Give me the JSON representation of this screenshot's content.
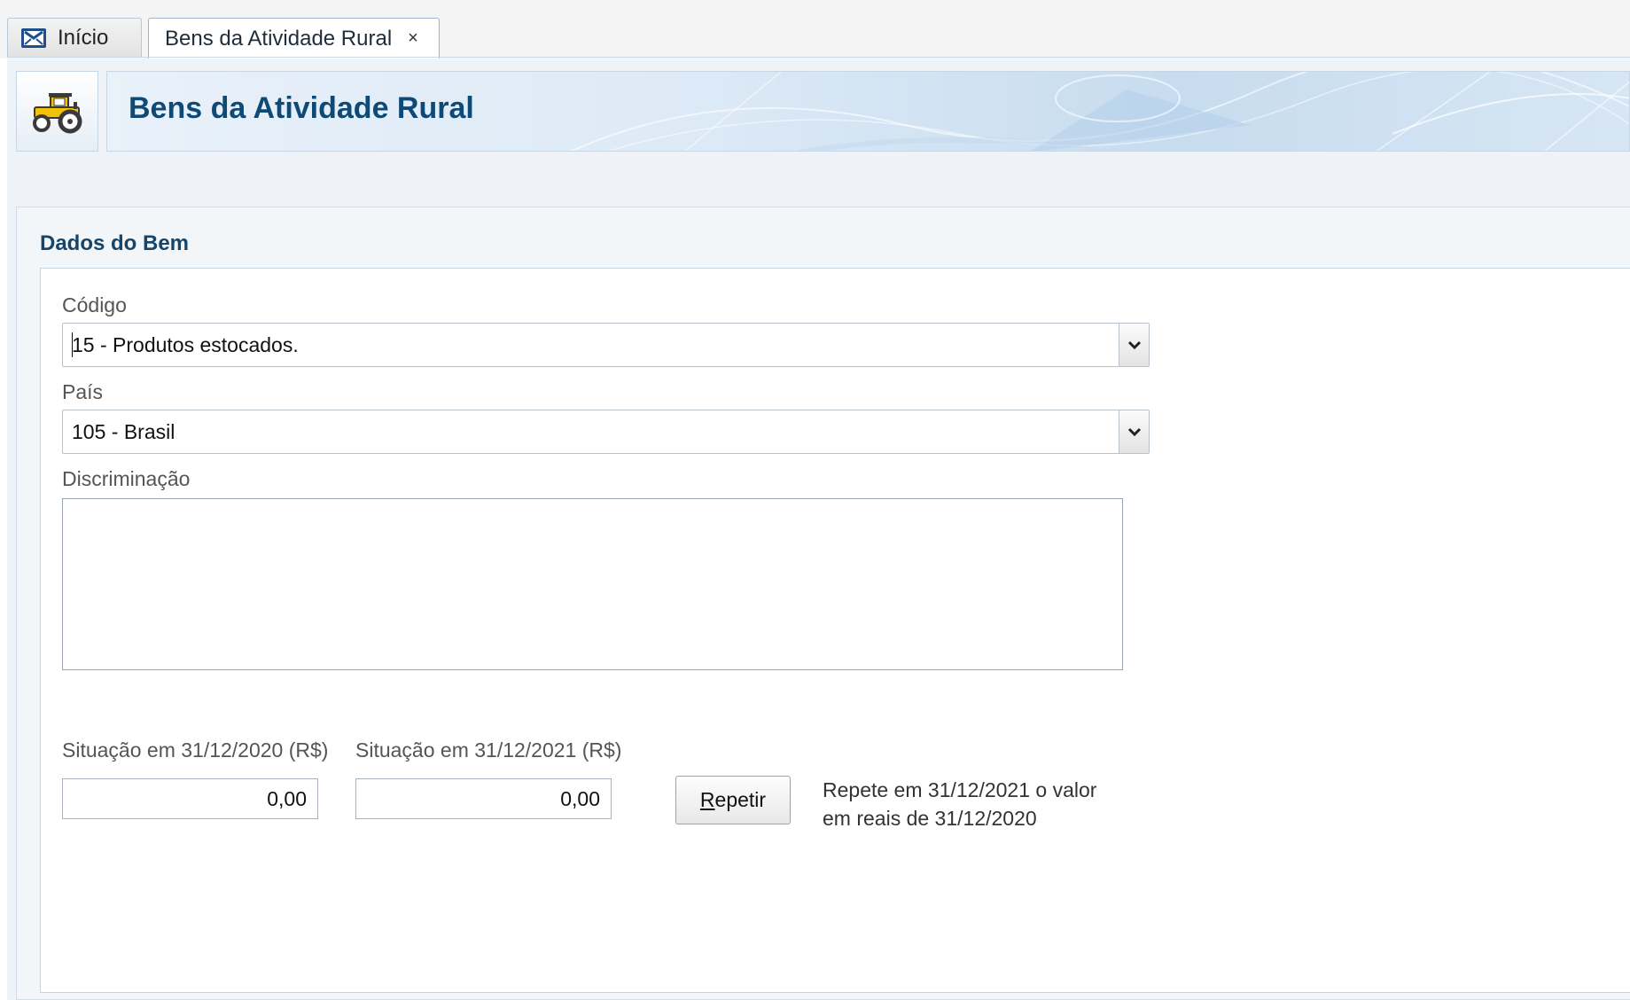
{
  "tabs": {
    "home_label": "Início",
    "active_label": "Bens da Atividade Rural",
    "close_symbol": "×"
  },
  "header": {
    "title": "Bens da Atividade Rural",
    "icon": "tractor-icon"
  },
  "section": {
    "title": "Dados do Bem"
  },
  "form": {
    "codigo_label": "Código",
    "codigo_value": "15 - Produtos estocados.",
    "pais_label": "País",
    "pais_value": "105 - Brasil",
    "discriminacao_label": "Discriminação",
    "discriminacao_value": "",
    "situacao_2020_label": "Situação em 31/12/2020 (R$)",
    "situacao_2020_value": "0,00",
    "situacao_2021_label": "Situação em 31/12/2021 (R$)",
    "situacao_2021_value": "0,00",
    "repeat_button_mnemonic": "R",
    "repeat_button_rest": "epetir",
    "repeat_help_line1": "Repete em 31/12/2021 o valor",
    "repeat_help_line2": "em reais de 31/12/2020"
  },
  "colors": {
    "title_blue": "#0f4a77",
    "section_blue": "#16456b",
    "tractor_yellow": "#f2c20a"
  }
}
